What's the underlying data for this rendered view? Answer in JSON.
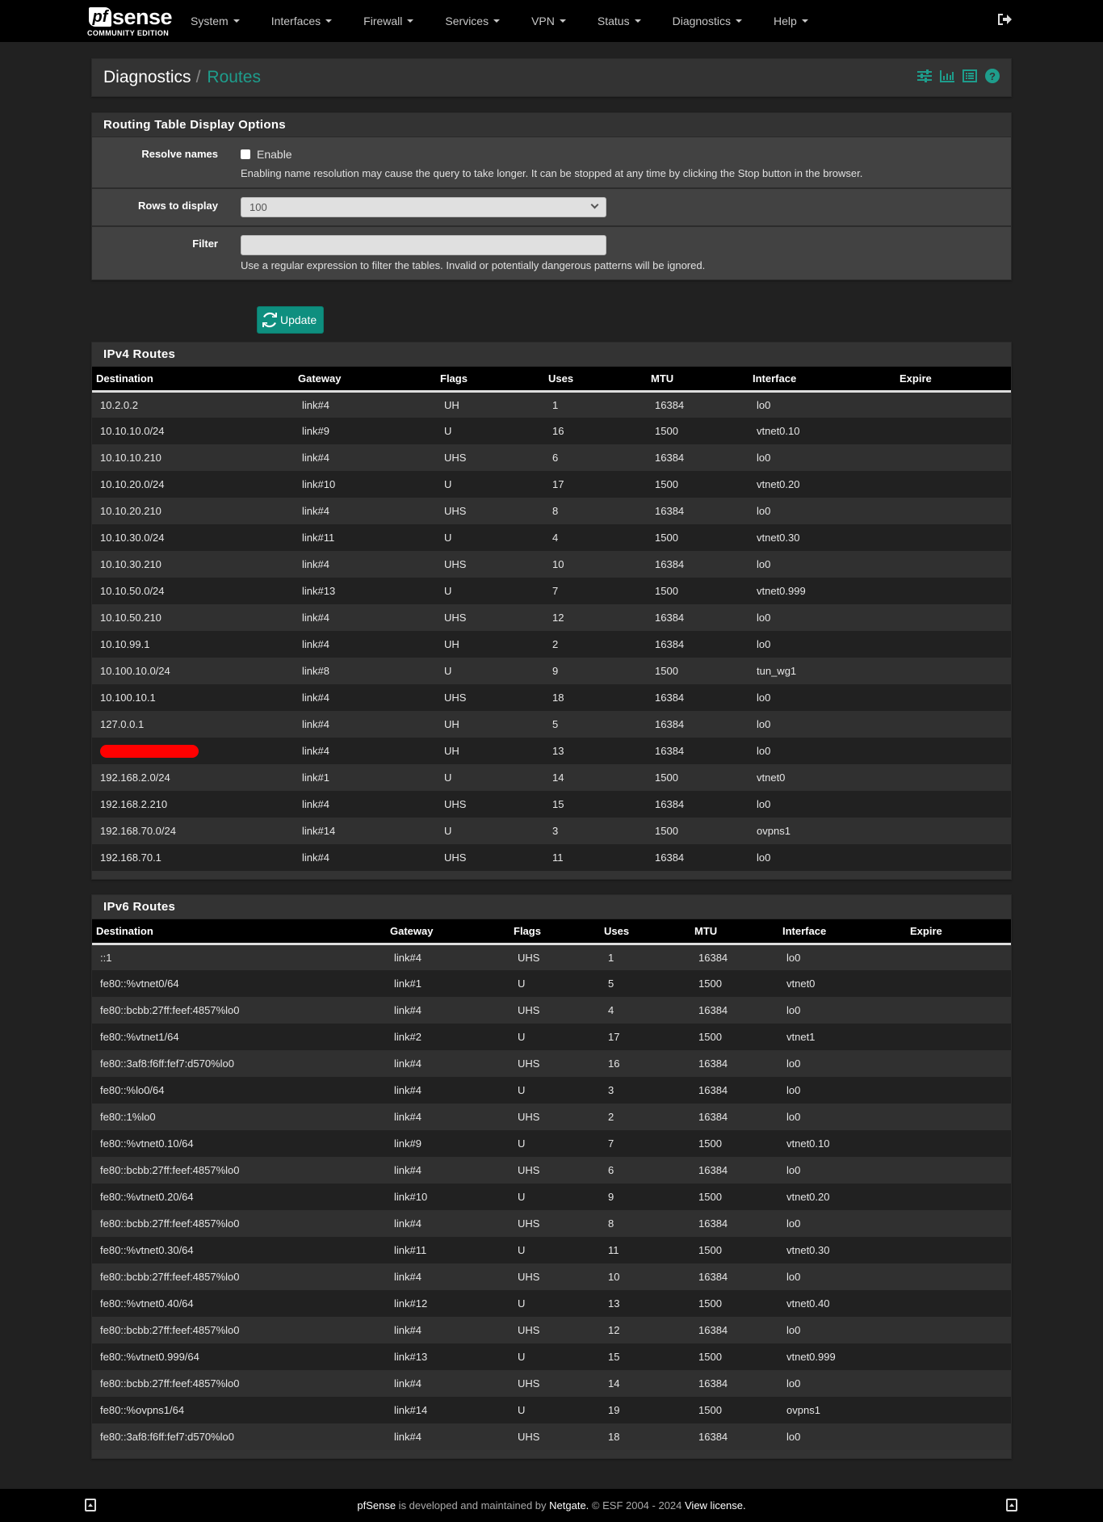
{
  "brand": {
    "logo_pf": "pf",
    "logo_sense": "sense",
    "edition": "COMMUNITY EDITION"
  },
  "nav": {
    "items": [
      "System",
      "Interfaces",
      "Firewall",
      "Services",
      "VPN",
      "Status",
      "Diagnostics",
      "Help"
    ],
    "logout_icon": "sign-out-icon"
  },
  "breadcrumb": {
    "parent": "Diagnostics",
    "separator": "/",
    "current": "Routes",
    "icons": [
      "sliders-icon",
      "bar-chart-icon",
      "list-icon",
      "help-icon"
    ]
  },
  "accent_color": "#1e9d8c",
  "options": {
    "title": "Routing Table Display Options",
    "resolve_names": {
      "label": "Resolve names",
      "checkbox_label": "Enable",
      "checked": false,
      "help": "Enabling name resolution may cause the query to take longer. It can be stopped at any time by clicking the Stop button in the browser."
    },
    "rows_to_display": {
      "label": "Rows to display",
      "value": "100"
    },
    "filter": {
      "label": "Filter",
      "value": "",
      "help": "Use a regular expression to filter the tables. Invalid or potentially dangerous patterns will be ignored."
    },
    "update_button": "Update"
  },
  "ipv4": {
    "title": "IPv4 Routes",
    "columns": [
      "Destination",
      "Gateway",
      "Flags",
      "Uses",
      "MTU",
      "Interface",
      "Expire"
    ],
    "rows": [
      [
        "10.2.0.2",
        "link#4",
        "UH",
        "1",
        "16384",
        "lo0",
        ""
      ],
      [
        "10.10.10.0/24",
        "link#9",
        "U",
        "16",
        "1500",
        "vtnet0.10",
        ""
      ],
      [
        "10.10.10.210",
        "link#4",
        "UHS",
        "6",
        "16384",
        "lo0",
        ""
      ],
      [
        "10.10.20.0/24",
        "link#10",
        "U",
        "17",
        "1500",
        "vtnet0.20",
        ""
      ],
      [
        "10.10.20.210",
        "link#4",
        "UHS",
        "8",
        "16384",
        "lo0",
        ""
      ],
      [
        "10.10.30.0/24",
        "link#11",
        "U",
        "4",
        "1500",
        "vtnet0.30",
        ""
      ],
      [
        "10.10.30.210",
        "link#4",
        "UHS",
        "10",
        "16384",
        "lo0",
        ""
      ],
      [
        "10.10.50.0/24",
        "link#13",
        "U",
        "7",
        "1500",
        "vtnet0.999",
        ""
      ],
      [
        "10.10.50.210",
        "link#4",
        "UHS",
        "12",
        "16384",
        "lo0",
        ""
      ],
      [
        "10.10.99.1",
        "link#4",
        "UH",
        "2",
        "16384",
        "lo0",
        ""
      ],
      [
        "10.100.10.0/24",
        "link#8",
        "U",
        "9",
        "1500",
        "tun_wg1",
        ""
      ],
      [
        "10.100.10.1",
        "link#4",
        "UHS",
        "18",
        "16384",
        "lo0",
        ""
      ],
      [
        "127.0.0.1",
        "link#4",
        "UH",
        "5",
        "16384",
        "lo0",
        ""
      ],
      [
        "[redacted]",
        "link#4",
        "UH",
        "13",
        "16384",
        "lo0",
        ""
      ],
      [
        "192.168.2.0/24",
        "link#1",
        "U",
        "14",
        "1500",
        "vtnet0",
        ""
      ],
      [
        "192.168.2.210",
        "link#4",
        "UHS",
        "15",
        "16384",
        "lo0",
        ""
      ],
      [
        "192.168.70.0/24",
        "link#14",
        "U",
        "3",
        "1500",
        "ovpns1",
        ""
      ],
      [
        "192.168.70.1",
        "link#4",
        "UHS",
        "11",
        "16384",
        "lo0",
        ""
      ]
    ]
  },
  "ipv6": {
    "title": "IPv6 Routes",
    "columns": [
      "Destination",
      "Gateway",
      "Flags",
      "Uses",
      "MTU",
      "Interface",
      "Expire"
    ],
    "rows": [
      [
        "::1",
        "link#4",
        "UHS",
        "1",
        "16384",
        "lo0",
        ""
      ],
      [
        "fe80::%vtnet0/64",
        "link#1",
        "U",
        "5",
        "1500",
        "vtnet0",
        ""
      ],
      [
        "fe80::bcbb:27ff:feef:4857%lo0",
        "link#4",
        "UHS",
        "4",
        "16384",
        "lo0",
        ""
      ],
      [
        "fe80::%vtnet1/64",
        "link#2",
        "U",
        "17",
        "1500",
        "vtnet1",
        ""
      ],
      [
        "fe80::3af8:f6ff:fef7:d570%lo0",
        "link#4",
        "UHS",
        "16",
        "16384",
        "lo0",
        ""
      ],
      [
        "fe80::%lo0/64",
        "link#4",
        "U",
        "3",
        "16384",
        "lo0",
        ""
      ],
      [
        "fe80::1%lo0",
        "link#4",
        "UHS",
        "2",
        "16384",
        "lo0",
        ""
      ],
      [
        "fe80::%vtnet0.10/64",
        "link#9",
        "U",
        "7",
        "1500",
        "vtnet0.10",
        ""
      ],
      [
        "fe80::bcbb:27ff:feef:4857%lo0",
        "link#4",
        "UHS",
        "6",
        "16384",
        "lo0",
        ""
      ],
      [
        "fe80::%vtnet0.20/64",
        "link#10",
        "U",
        "9",
        "1500",
        "vtnet0.20",
        ""
      ],
      [
        "fe80::bcbb:27ff:feef:4857%lo0",
        "link#4",
        "UHS",
        "8",
        "16384",
        "lo0",
        ""
      ],
      [
        "fe80::%vtnet0.30/64",
        "link#11",
        "U",
        "11",
        "1500",
        "vtnet0.30",
        ""
      ],
      [
        "fe80::bcbb:27ff:feef:4857%lo0",
        "link#4",
        "UHS",
        "10",
        "16384",
        "lo0",
        ""
      ],
      [
        "fe80::%vtnet0.40/64",
        "link#12",
        "U",
        "13",
        "1500",
        "vtnet0.40",
        ""
      ],
      [
        "fe80::bcbb:27ff:feef:4857%lo0",
        "link#4",
        "UHS",
        "12",
        "16384",
        "lo0",
        ""
      ],
      [
        "fe80::%vtnet0.999/64",
        "link#13",
        "U",
        "15",
        "1500",
        "vtnet0.999",
        ""
      ],
      [
        "fe80::bcbb:27ff:feef:4857%lo0",
        "link#4",
        "UHS",
        "14",
        "16384",
        "lo0",
        ""
      ],
      [
        "fe80::%ovpns1/64",
        "link#14",
        "U",
        "19",
        "1500",
        "ovpns1",
        ""
      ],
      [
        "fe80::3af8:f6ff:fef7:d570%lo0",
        "link#4",
        "UHS",
        "18",
        "16384",
        "lo0",
        ""
      ]
    ]
  },
  "footer": {
    "product": "pfSense",
    "text1": " is developed and maintained by ",
    "company": "Netgate.",
    "text2": " © ESF 2004 - 2024 ",
    "license_link": "View license."
  }
}
